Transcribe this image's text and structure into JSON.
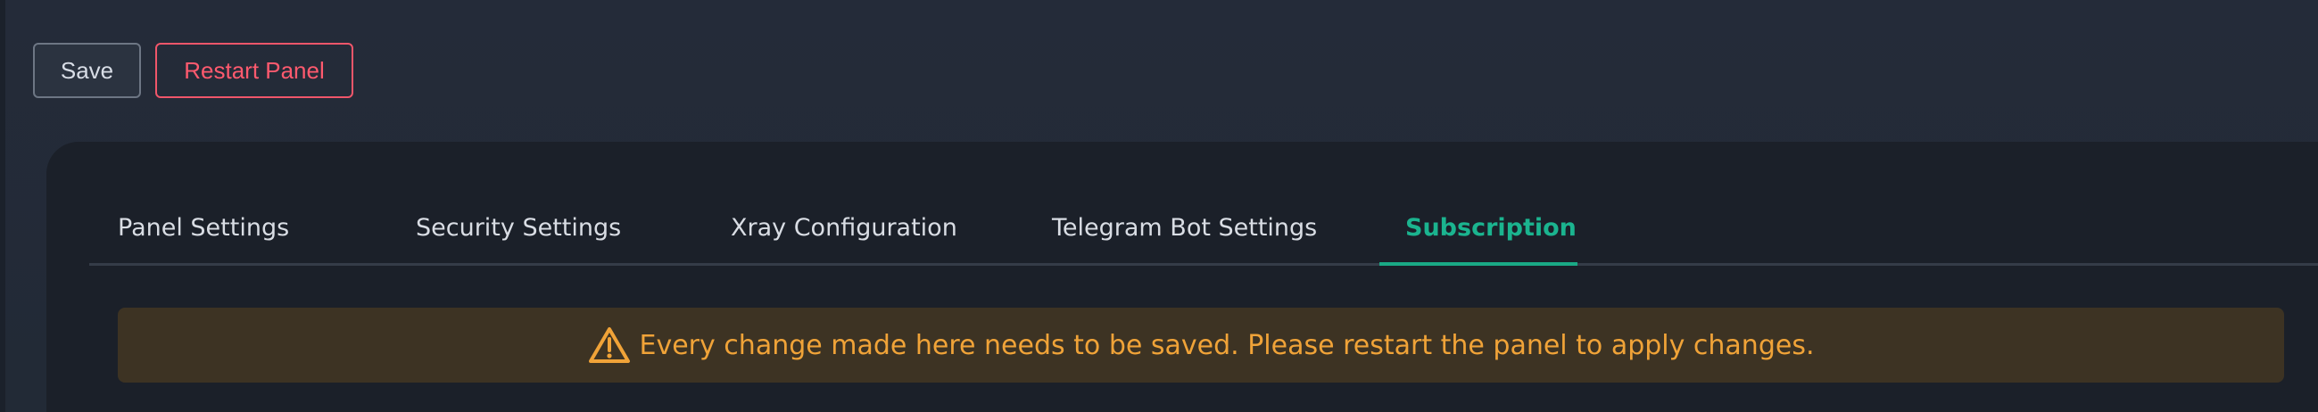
{
  "toolbar": {
    "save_label": "Save",
    "restart_label": "Restart Panel"
  },
  "tabs": [
    {
      "label": "Panel Settings"
    },
    {
      "label": "Security Settings"
    },
    {
      "label": "Xray Configuration"
    },
    {
      "label": "Telegram Bot Settings"
    },
    {
      "label": "Subscription"
    }
  ],
  "active_tab": "Subscription",
  "alert": {
    "icon": "warning-icon",
    "message": "Every change made here needs to be saved. Please restart the panel to apply changes."
  },
  "colors": {
    "background": "#232a37",
    "panel": "#1b2029",
    "accent": "#1bb48f",
    "danger": "#ff5a6e",
    "warning_text": "#f0a338",
    "warning_bg": "#3d3323"
  }
}
